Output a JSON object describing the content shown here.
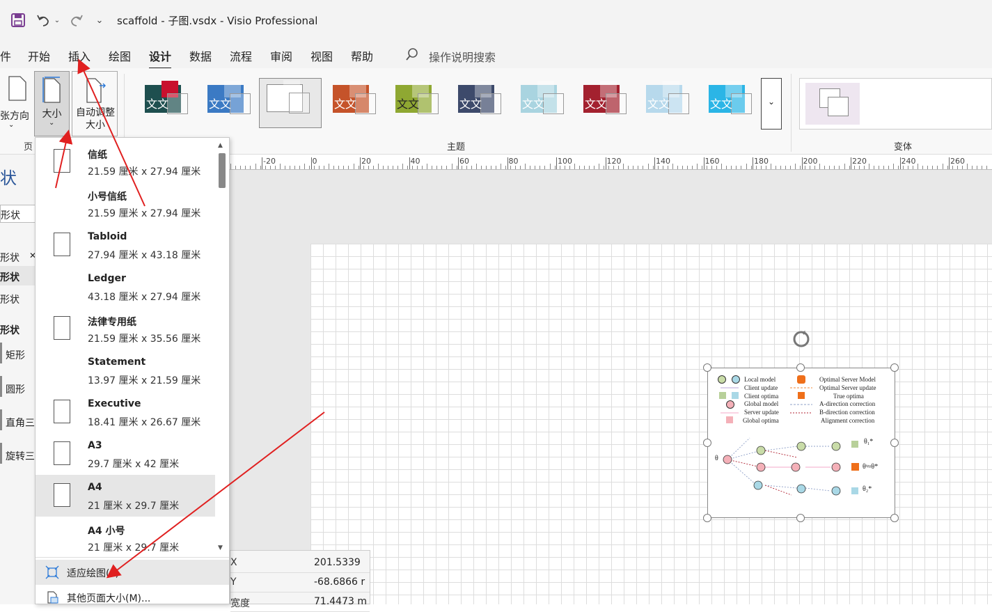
{
  "window": {
    "title": "scaffold - 子图.vsdx  -  Visio Professional"
  },
  "menu": {
    "tabs": [
      "件",
      "开始",
      "插入",
      "绘图",
      "设计",
      "数据",
      "流程",
      "审阅",
      "视图",
      "帮助"
    ],
    "active": "设计",
    "search_placeholder": "操作说明搜索"
  },
  "ribbon": {
    "orientation_label": "张方向",
    "size_label": "大小",
    "autofit_label": "自动调整大小",
    "page_group_label": "页",
    "theme_group_label": "主题",
    "variant_group_label": "变体",
    "theme_text": "文文",
    "theme_colors": [
      "#1e4f4f",
      "#3b7ac4",
      "#ffffff",
      "#c5532a",
      "#8fa832",
      "#3d4a6b",
      "#a9d4e0",
      "#a3212f",
      "#b7d9ec",
      "#2bb5e6"
    ]
  },
  "left_panel": {
    "title": "状",
    "search": "形状",
    "items": [
      "形状",
      "形状",
      "形状",
      "形状",
      "矩形",
      "圆形",
      "直角三",
      "旋转三"
    ]
  },
  "ruler": {
    "labels": [
      "-20",
      "0",
      "20",
      "40",
      "60",
      "80",
      "100",
      "120",
      "140",
      "160",
      "180",
      "200",
      "220",
      "240",
      "260"
    ]
  },
  "dropdown": {
    "items": [
      {
        "name": "信纸",
        "dims": "21.59 厘米 x 27.94 厘米",
        "icon": "portrait"
      },
      {
        "name": "小号信纸",
        "dims": "21.59 厘米 x 27.94 厘米",
        "icon": "none"
      },
      {
        "name": "Tabloid",
        "dims": "27.94 厘米 x 43.18 厘米",
        "icon": "portrait"
      },
      {
        "name": "Ledger",
        "dims": "43.18 厘米 x 27.94 厘米",
        "icon": "none"
      },
      {
        "name": "法律专用纸",
        "dims": "21.59 厘米 x 35.56 厘米",
        "icon": "portrait"
      },
      {
        "name": "Statement",
        "dims": "13.97 厘米 x 21.59 厘米",
        "icon": "none"
      },
      {
        "name": "Executive",
        "dims": "18.41 厘米 x 26.67 厘米",
        "icon": "portrait"
      },
      {
        "name": "A3",
        "dims": "29.7 厘米 x 42 厘米",
        "icon": "portrait"
      },
      {
        "name": "A4",
        "dims": "21 厘米 x 29.7 厘米",
        "icon": "portrait",
        "selected": true
      },
      {
        "name": "A4 小号",
        "dims": "21 厘米 x 29.7 厘米",
        "icon": "none"
      }
    ],
    "fit_to_drawing": "适应绘图(F)",
    "more_sizes": "其他页面大小(M)..."
  },
  "size_position": {
    "rows": [
      {
        "key": "X",
        "value": "201.5339"
      },
      {
        "key": "Y",
        "value": "-68.6866 r"
      },
      {
        "key": "宽度",
        "value": "71.4473 m"
      }
    ]
  },
  "diagram": {
    "legend_left": [
      "Local model",
      "Client update",
      "Client optima",
      "Global model",
      "Server update",
      "Global optima"
    ],
    "legend_right": [
      "Optimal Server Model",
      "Optimal Server update",
      "True optima",
      "A-direction correction",
      "B-direction correction",
      "Alignment correction"
    ],
    "theta": "θ",
    "theta1": "θ₁*",
    "theta_s": "θˢ≈θ*",
    "theta2": "θ₂*"
  }
}
